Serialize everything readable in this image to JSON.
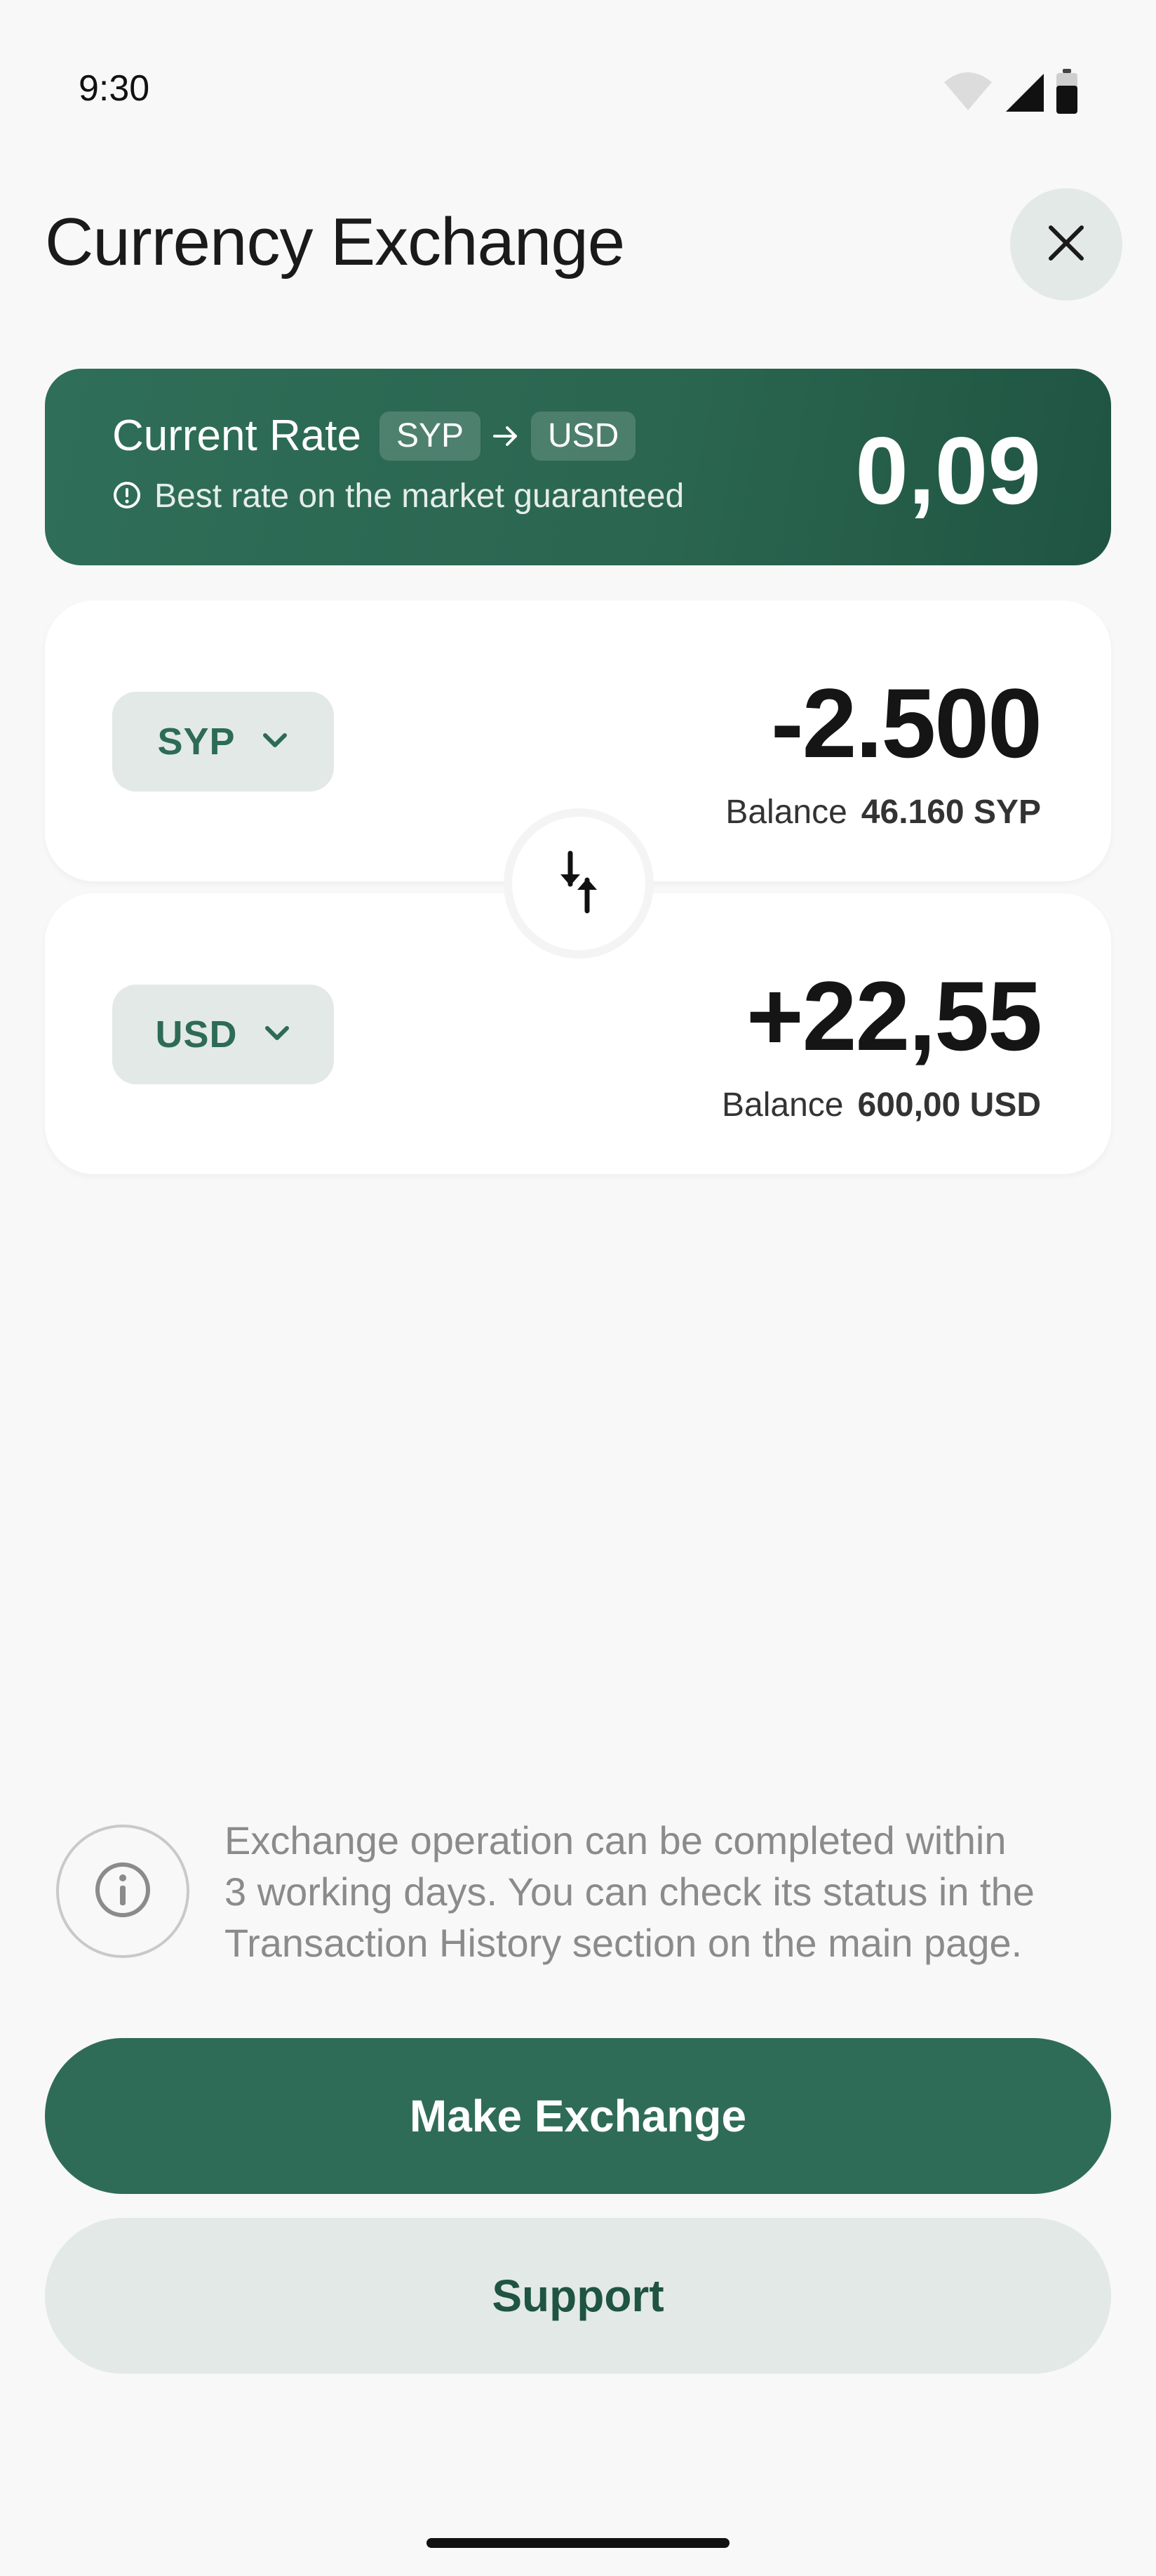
{
  "status_bar": {
    "time": "9:30",
    "icons": [
      "wifi-icon",
      "signal-icon",
      "battery-icon"
    ]
  },
  "header": {
    "title": "Currency Exchange",
    "close_icon": "close-icon"
  },
  "rate_card": {
    "title": "Current Rate",
    "from_currency": "SYP",
    "to_currency": "USD",
    "note": "Best rate on the market guaranteed",
    "value": "0,09"
  },
  "exchange": {
    "from": {
      "currency": "SYP",
      "amount": "-2.500",
      "balance_label": "Balance",
      "balance_value": "46.160 SYP"
    },
    "to": {
      "currency": "USD",
      "amount": "+22,55",
      "balance_label": "Balance",
      "balance_value": "600,00 USD"
    },
    "swap_icon": "swap-vertical-icon"
  },
  "info": {
    "icon": "info-icon",
    "lines": [
      "Exchange operation can be completed within",
      "3 working days. You can check its status in the",
      "Transaction History section on the main page."
    ]
  },
  "buttons": {
    "primary": "Make Exchange",
    "secondary": "Support"
  },
  "colors": {
    "brand": "#2f6c58",
    "brand_dark": "#1f5442",
    "chip_bg": "#e3e9e6",
    "background": "#f8f8f8"
  }
}
